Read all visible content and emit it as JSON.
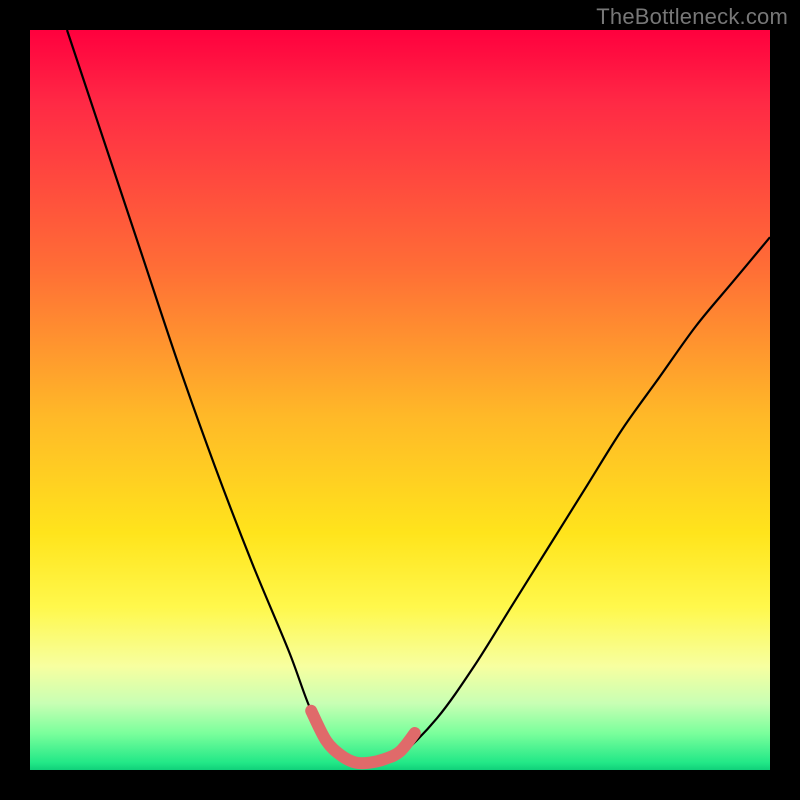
{
  "watermark": "TheBottleneck.com",
  "chart_data": {
    "type": "line",
    "title": "",
    "xlabel": "",
    "ylabel": "",
    "xlim": [
      0,
      100
    ],
    "ylim": [
      0,
      100
    ],
    "series": [
      {
        "name": "bottleneck-curve",
        "x": [
          5,
          10,
          15,
          20,
          25,
          30,
          35,
          38,
          41,
          44,
          47,
          50,
          55,
          60,
          65,
          70,
          75,
          80,
          85,
          90,
          95,
          100
        ],
        "y": [
          100,
          85,
          70,
          55,
          41,
          28,
          16,
          8,
          3,
          1,
          1,
          2,
          7,
          14,
          22,
          30,
          38,
          46,
          53,
          60,
          66,
          72
        ],
        "color": "#000000",
        "stroke_width": 2.2
      },
      {
        "name": "highlight-segment",
        "x": [
          38,
          40,
          42,
          44,
          46,
          48,
          50,
          52
        ],
        "y": [
          8,
          4,
          2,
          1,
          1,
          1.5,
          2.5,
          5
        ],
        "color": "#e06a6a",
        "stroke_width": 12
      }
    ],
    "background": "rainbow-vertical-gradient",
    "frame_color": "#000000"
  }
}
